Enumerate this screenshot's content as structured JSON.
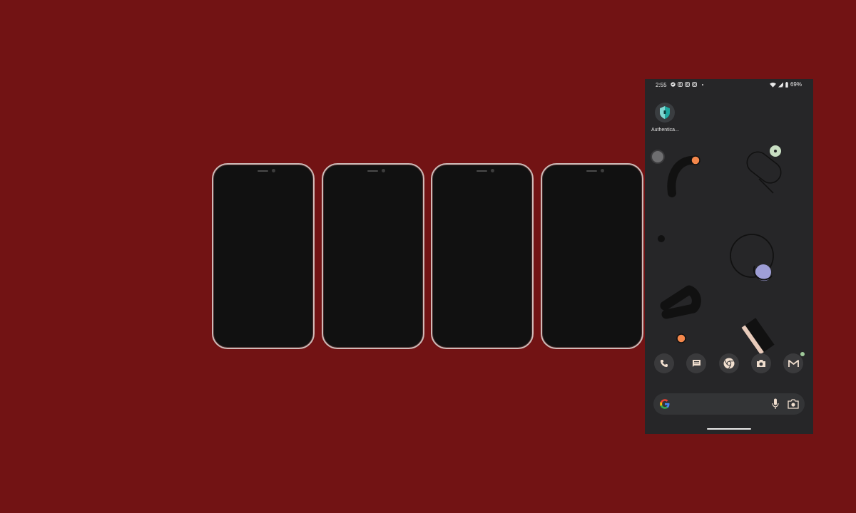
{
  "page": {
    "background": "#721314"
  },
  "mockups": {
    "count": 4,
    "frame_color": "#cdbbb8",
    "screen_color": "#111111"
  },
  "android": {
    "status_bar": {
      "time": "2:55",
      "battery": "69%",
      "notification_icons": [
        "messenger-icon",
        "instagram-icon",
        "instagram-icon",
        "instagram-icon"
      ]
    },
    "home_app": {
      "label": "Authentica..."
    },
    "dock": [
      {
        "name": "phone-icon"
      },
      {
        "name": "messages-icon"
      },
      {
        "name": "chrome-icon"
      },
      {
        "name": "camera-icon"
      },
      {
        "name": "gmail-icon"
      }
    ],
    "search": {
      "placeholder": ""
    },
    "colors": {
      "accent_orange": "#f4874b",
      "accent_green": "#c9dfc3",
      "accent_purple": "#9e9ed6"
    }
  }
}
